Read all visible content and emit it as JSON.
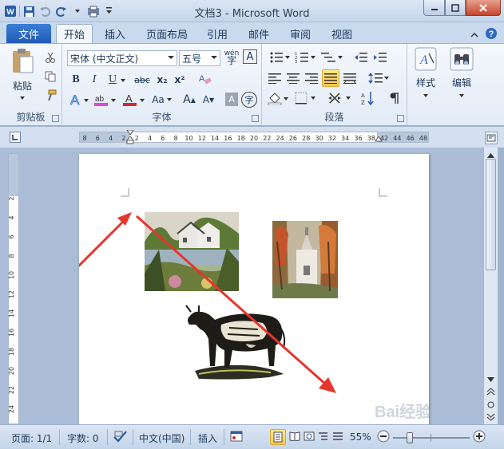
{
  "window": {
    "title": "文档3 - Microsoft Word"
  },
  "tabs": {
    "file": "文件",
    "items": [
      "开始",
      "插入",
      "页面布局",
      "引用",
      "邮件",
      "审阅",
      "视图"
    ]
  },
  "clipboard": {
    "paste": "粘贴",
    "label": "剪贴板"
  },
  "font": {
    "name": "宋体 (中文正文)",
    "size": "五号",
    "label": "字体",
    "bold": "B",
    "italic": "I",
    "underline": "U",
    "strike": "abc",
    "sub": "x₂",
    "sup": "x²",
    "grow": "A",
    "shrink": "A",
    "case": "Aa",
    "border_char": "A",
    "circle_char": "字",
    "phonetic": "wén",
    "colors": {
      "highlight": "#e046e0",
      "font": "#d22a2a"
    }
  },
  "paragraph": {
    "label": "段落"
  },
  "styles": {
    "label": "样式"
  },
  "editing": {
    "label": "编辑"
  },
  "ruler": {
    "ticks": [
      "8",
      "6",
      "4",
      "2",
      "2",
      "4",
      "6",
      "8",
      "10",
      "12",
      "14",
      "16",
      "18",
      "20",
      "22",
      "24",
      "26",
      "28",
      "30",
      "32",
      "34",
      "36",
      "38",
      "42",
      "44",
      "46",
      "48"
    ],
    "vticks": [
      "4",
      "2",
      "2",
      "4",
      "6",
      "8",
      "10",
      "12",
      "14",
      "16",
      "18",
      "20",
      "22",
      "24"
    ]
  },
  "status": {
    "page": "页面: 1/1",
    "words": "字数: 0",
    "lang": "中文(中国)",
    "mode": "插入",
    "zoom": "55%"
  },
  "watermark": "Bai经验",
  "accent": "#2b5fb4"
}
